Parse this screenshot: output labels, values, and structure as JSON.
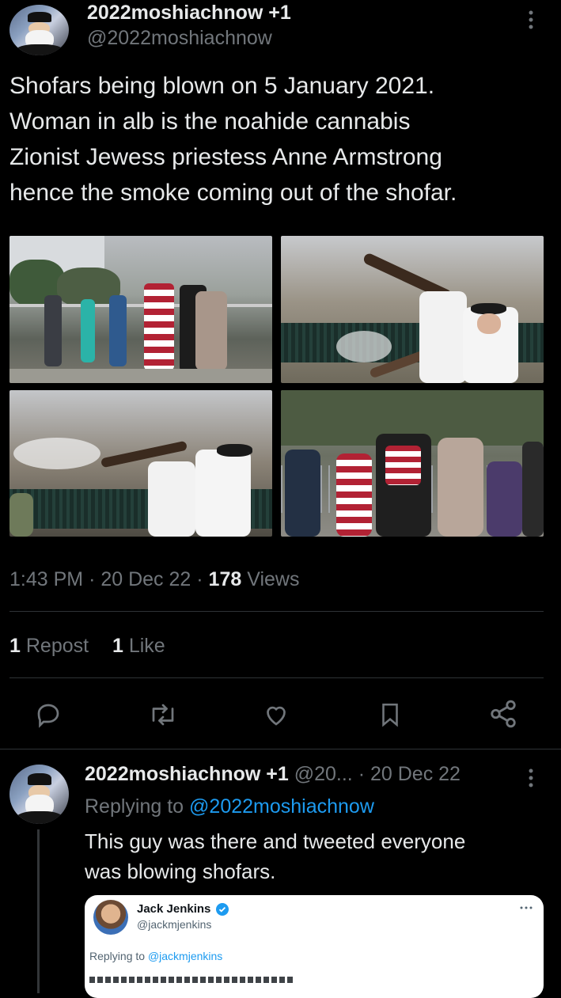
{
  "main_tweet": {
    "author_name": "2022moshiachnow +1",
    "author_handle": "@2022moshiachnow",
    "text_lines": [
      "Shofars being blown on 5 January 2021.",
      "Woman in alb is the noahide cannabis",
      "Zionist Jewess priestess Anne Armstrong",
      "hence the smoke coming out of the shofar."
    ],
    "photos": [
      "shofar-crowd-flags-photo",
      "shofar-closeup-smoke-photo",
      "shofar-line-fence-photo",
      "shofar-group-street-photo"
    ],
    "time": "1:43 PM",
    "date": "20 Dec 22",
    "views_count": "178",
    "views_label": "Views",
    "reposts_count": "1",
    "reposts_label": "Repost",
    "likes_count": "1",
    "likes_label": "Like",
    "sep": "·"
  },
  "actions": [
    "reply-icon",
    "repost-icon",
    "like-icon",
    "bookmark-icon",
    "share-icon"
  ],
  "reply_tweet": {
    "author_name": "2022moshiachnow +1",
    "author_handle_truncated": "@20...",
    "sep": "·",
    "date": "20 Dec 22",
    "replying_label": "Replying to",
    "replying_to": "@2022moshiachnow",
    "text_lines": [
      "This guy was there and tweeted everyone",
      "was blowing shofars."
    ]
  },
  "quoted_card": {
    "author_name": "Jack Jenkins",
    "author_handle": "@jackmjenkins",
    "replying_label": "Replying to",
    "replying_to": "@jackmjenkins"
  },
  "colors": {
    "background": "#000000",
    "text_primary": "#e7e9ea",
    "text_secondary": "#71767b",
    "link": "#1d9bf0",
    "divider": "#2f3336"
  }
}
